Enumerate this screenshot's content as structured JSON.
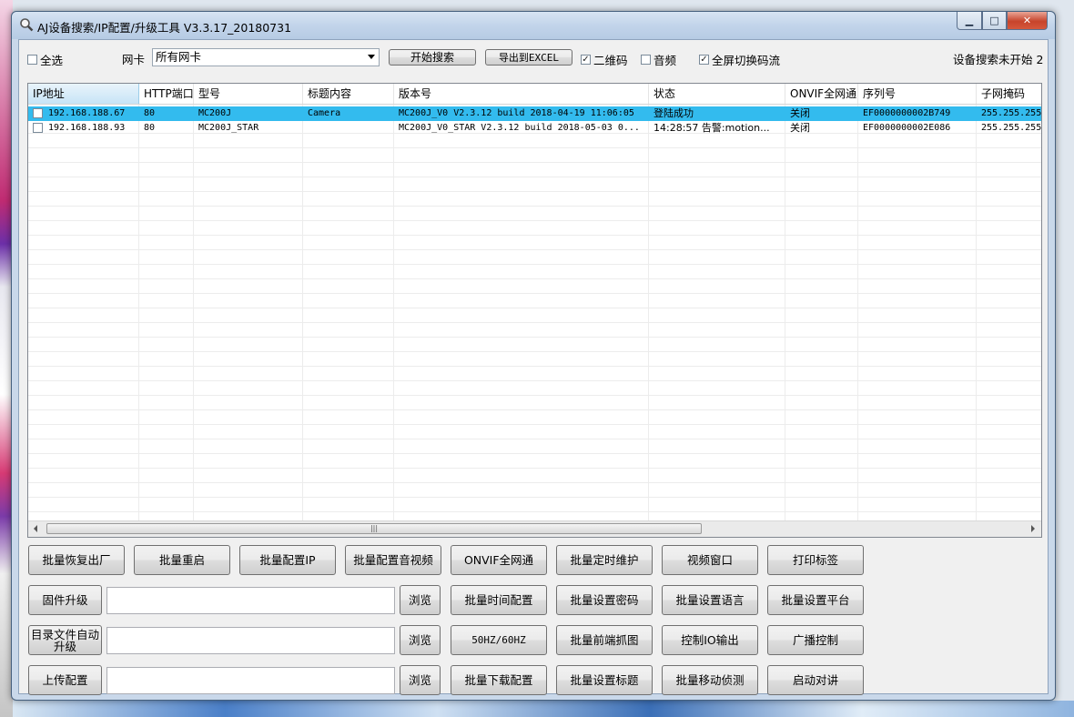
{
  "window": {
    "title": "AJ设备搜索/IP配置/升级工具 V3.3.17_20180731",
    "controls": {
      "minimize": "▁",
      "maximize": "□",
      "close": "✕"
    }
  },
  "toolbar": {
    "select_all": {
      "label": "全选",
      "checked": false
    },
    "nic_label": "网卡",
    "nic_value": "所有网卡",
    "search_button": "开始搜索",
    "export_button": "导出到EXCEL",
    "qrcode": {
      "label": "二维码",
      "checked": true
    },
    "audio": {
      "label": "音频",
      "checked": false
    },
    "fullscreen": {
      "label": "全屏切换码流",
      "checked": true
    },
    "status": "设备搜索未开始 2"
  },
  "table": {
    "columns": [
      "IP地址",
      "HTTP端口",
      "型号",
      "标题内容",
      "版本号",
      "状态",
      "ONVIF全网通",
      "序列号",
      "子网掩码"
    ],
    "rows": [
      {
        "selected": true,
        "checked": false,
        "cells": [
          "192.168.188.67",
          "80",
          "MC200J",
          "Camera",
          "MC200J_V0 V2.3.12 build 2018-04-19 11:06:05",
          "登陆成功",
          "关闭",
          "EF0000000002B749",
          "255.255.255"
        ]
      },
      {
        "selected": false,
        "checked": false,
        "cells": [
          "192.168.188.93",
          "80",
          "MC200J_STAR",
          "",
          "MC200J_V0_STAR V2.3.12 build 2018-05-03 0...",
          "14:28:57 告警:motion...",
          "关闭",
          "EF0000000002E086",
          "255.255.255"
        ]
      }
    ]
  },
  "actions": {
    "row1": [
      "批量恢复出厂",
      "批量重启",
      "批量配置IP",
      "批量配置音视频",
      "ONVIF全网通",
      "批量定时维护",
      "视频窗口",
      "打印标签"
    ],
    "firmware_button": "固件升级",
    "dir_upgrade_button": "目录文件自动\n升级",
    "upload_config_button": "上传配置",
    "browse": "浏览",
    "row2": [
      "批量时间配置",
      "批量设置密码",
      "批量设置语言",
      "批量设置平台"
    ],
    "row3": [
      "50HZ/60HZ",
      "批量前端抓图",
      "控制IO输出",
      "广播控制"
    ],
    "row4": [
      "批量下载配置",
      "批量设置标题",
      "批量移动侦测",
      "启动对讲"
    ]
  }
}
